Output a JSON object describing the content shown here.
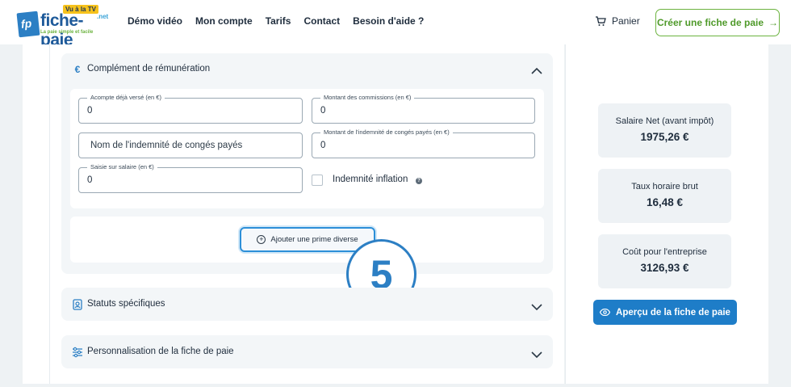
{
  "brand": {
    "name": "fiche-paie",
    "tv_badge": "Vu à la TV",
    "suffix": ".net",
    "tagline": "La paie simple et facile"
  },
  "nav": {
    "items": [
      "Démo vidéo",
      "Mon compte",
      "Tarifs",
      "Contact",
      "Besoin d'aide ?"
    ]
  },
  "header": {
    "cart_label": "Panier",
    "cta_label": "Créer une fiche de paie",
    "cta_arrow": "→"
  },
  "sections": {
    "complement": {
      "title": "Complément de rémunération",
      "icon": "euro-icon",
      "expanded": true
    },
    "statuts": {
      "title": "Statuts spécifiques",
      "icon": "badge-icon",
      "expanded": false
    },
    "personnalisation": {
      "title": "Personnalisation de la fiche de paie",
      "icon": "sliders-icon",
      "expanded": false
    }
  },
  "form": {
    "acompte": {
      "label": "Acompte déjà versé (en €)",
      "value": "0"
    },
    "commissions": {
      "label": "Montant des commissions (en €)",
      "value": "0"
    },
    "indemnite_nom": {
      "placeholder": "Nom de l'indemnité de congés payés"
    },
    "indemnite_montant": {
      "label": "Montant de l'indemnité de congés payés (en €)",
      "value": "0"
    },
    "saisie": {
      "label": "Saisie sur salaire (en €)",
      "value": "0"
    },
    "inflation": {
      "label": "Indemnité inflation",
      "checked": false,
      "help": "?"
    }
  },
  "add_prime": {
    "label": "Ajouter une prime diverse"
  },
  "step_badge": "5",
  "summary": {
    "net": {
      "label": "Salaire Net (avant impôt)",
      "value": "1975,26 €"
    },
    "horaire": {
      "label": "Taux horaire brut",
      "value": "16,48 €"
    },
    "cout": {
      "label": "Coût pour l'entreprise",
      "value": "3126,93 €"
    },
    "preview_label": "Aperçu de la fiche de paie"
  },
  "colors": {
    "primary": "#1e7dc8",
    "accent_green": "#6cb33f",
    "card_bg": "#f3f6f8"
  }
}
